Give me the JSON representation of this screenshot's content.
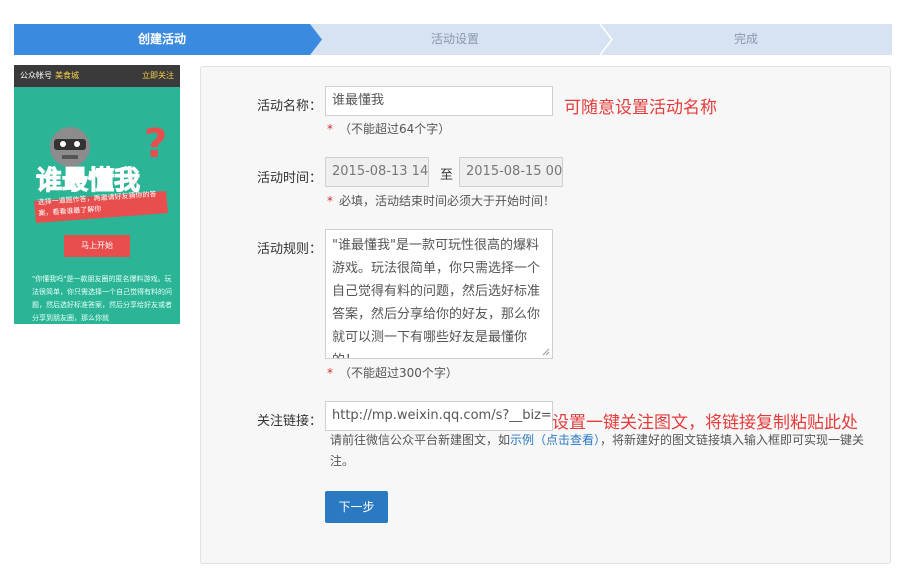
{
  "steps": [
    {
      "label": "创建活动",
      "active": true
    },
    {
      "label": "活动设置",
      "active": false
    },
    {
      "label": "完成",
      "active": false
    }
  ],
  "preview": {
    "account_label": "公众帐号",
    "account_name": "美食城",
    "follow_label": "立即关注",
    "title_art": "谁最懂我?",
    "banner_text": "选择一道题作答，再邀请好友猜你的答案，看看谁最了解你",
    "start_button": "马上开始",
    "description": "\"你懂我吗\"是一款朋友圈的匿名爆料游戏。玩法很简单，你只需选择一个自己觉得有料的问题，然后选好标准答案，然后分享给好友或者分享到朋友圈，那么你就"
  },
  "form": {
    "name": {
      "label": "活动名称：",
      "value": "谁最懂我",
      "hint": "（不能超过64个字）",
      "note": "可随意设置活动名称"
    },
    "time": {
      "label": "活动时间：",
      "start": "2015-08-13 14",
      "to": "至",
      "end": "2015-08-15 00",
      "hint": "必填，活动结束时间必须大于开始时间！"
    },
    "rules": {
      "label": "活动规则：",
      "value": "\"谁最懂我\"是一款可玩性很高的爆料游戏。玩法很简单，你只需选择一个自己觉得有料的问题，然后选好标准答案，然后分享给你的好友，那么你就可以测一下有哪些好友是最懂你的！。",
      "hint": "（不能超过300个字）"
    },
    "follow_link": {
      "label": "关注链接：",
      "value": "http://mp.weixin.qq.com/s?__biz=M",
      "note": "设置一键关注图文，将链接复制粘贴此处",
      "desc_prefix": "请前往微信公众平台新建图文，如",
      "example_link": "示例",
      "view_link": "（点击查看）",
      "desc_suffix": "，将新建好的图文链接填入输入框即可实现一键关注。"
    },
    "next_button": "下一步"
  },
  "colors": {
    "accent": "#3a8ae0",
    "step_bg": "#d7e3f2",
    "preview_bg": "#2bb596",
    "note_red": "#e43c3c",
    "button_blue": "#2a7ac2"
  }
}
